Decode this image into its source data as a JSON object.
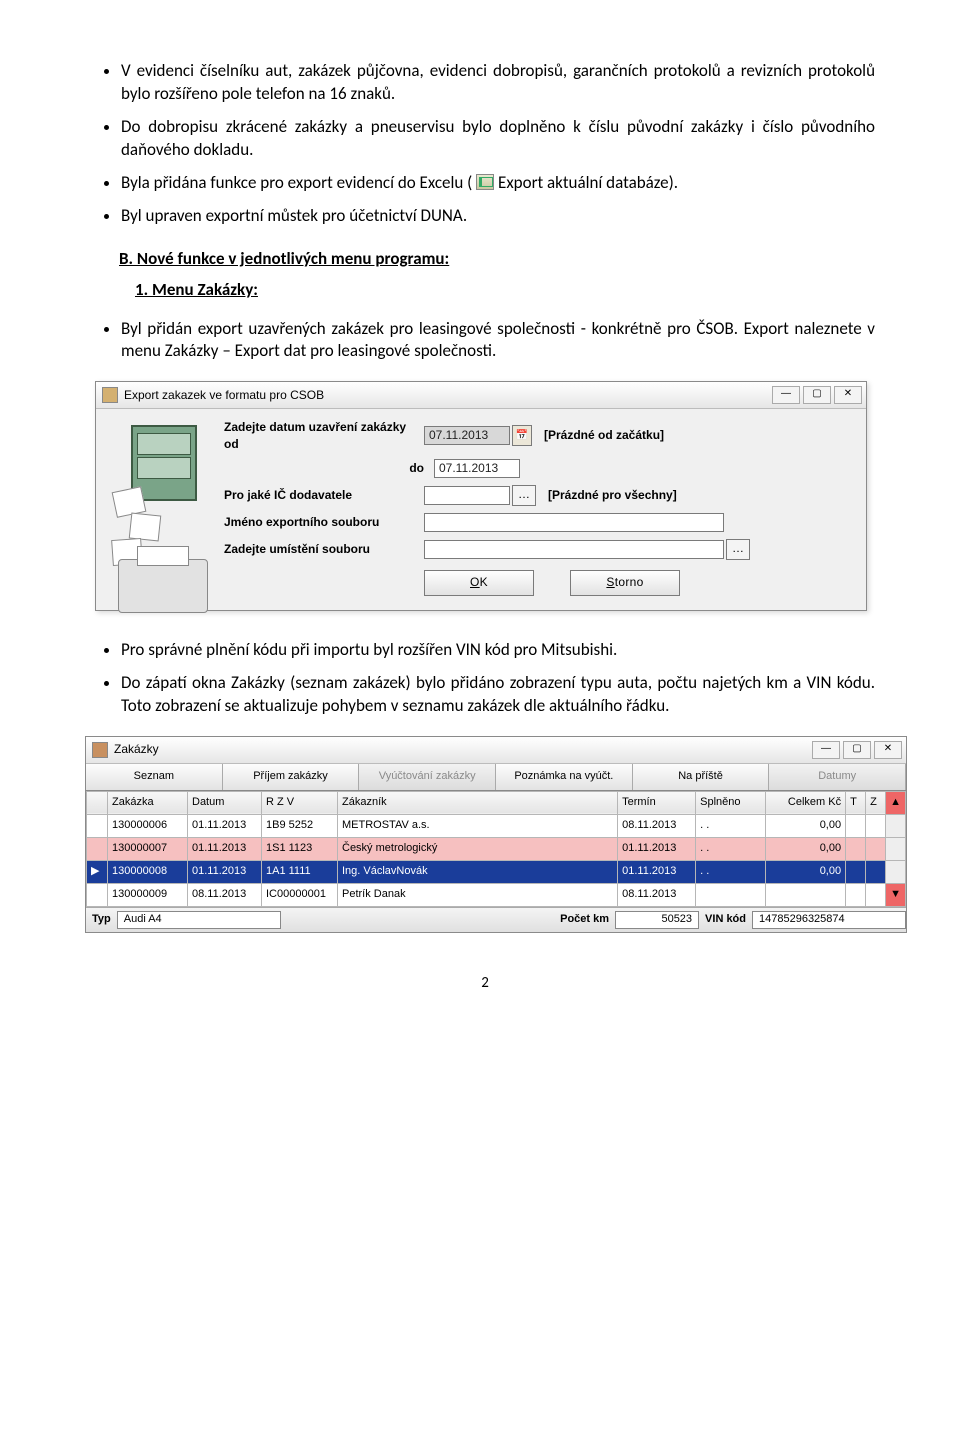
{
  "bullets1": [
    "V evidenci číselníku aut, zakázek půjčovna, evidenci dobropisů, garančních protokolů a revizních protokolů bylo rozšířeno pole telefon na 16 znaků.",
    "Do dobropisu zkrácené zakázky a pneuservisu bylo doplněno k číslu původní zakázky i číslo původního daňového dokladu."
  ],
  "bullet_export_pre": "Byla přidána funkce pro export evidencí do Excelu (",
  "bullet_export_post": " Export aktuální databáze).",
  "bullet_mustek": "Byl upraven exportní můstek pro účetnictví DUNA.",
  "section_b": "B.  Nové funkce v jednotlivých menu programu:",
  "menu_zak": "1.  Menu Zakázky:",
  "bullet_csob": "Byl přidán export uzavřených zakázek pro leasingové společnosti - konkrétně pro ČSOB. Export naleznete v menu Zakázky – Export dat pro leasingové společnosti.",
  "dlg": {
    "title": "Export zakazek ve formatu pro CSOB",
    "lbl_od": "Zadejte datum uzavření zakázky od",
    "lbl_do": "do",
    "date_from": "07.11.2013",
    "date_to": "07.11.2013",
    "hint_from": "[Prázdné od začátku]",
    "lbl_ic": "Pro jaké IČ dodavatele",
    "hint_ic": "[Prázdné pro všechny]",
    "lbl_file": "Jméno exportního souboru",
    "lbl_path": "Zadejte umístění souboru",
    "btn_ok": "OK",
    "btn_storno": "Storno"
  },
  "bullet_vin": "Pro správné plnění kódu při importu byl rozšířen VIN kód pro Mitsubishi.",
  "bullet_zapati": "Do zápatí okna Zakázky (seznam zakázek) bylo přidáno zobrazení typu auta, počtu najetých km a VIN kódu. Toto zobrazení se aktualizuje pohybem v seznamu zakázek dle aktuálního řádku.",
  "gridwin": {
    "title": "Zakázky",
    "tabs": [
      "Seznam",
      "Příjem zakázky",
      "Vyúčtování zakázky",
      "Poznámka na vyúčt.",
      "Na příště",
      "Datumy"
    ],
    "headers": [
      "Zakázka",
      "Datum",
      "R Z V",
      "Zákazník",
      "Termín",
      "Splněno",
      "Celkem Kč",
      "T",
      "Z"
    ],
    "rows": [
      {
        "c": [
          "130000006",
          "01.11.2013",
          "1B9 5252",
          "METROSTAV a.s.",
          "08.11.2013",
          ".  .",
          "0,00",
          "",
          ""
        ],
        "cls": ""
      },
      {
        "c": [
          "130000007",
          "01.11.2013",
          "1S1 1123",
          "Český metrologický",
          "01.11.2013",
          ".  .",
          "0,00",
          "",
          ""
        ],
        "cls": "red"
      },
      {
        "c": [
          "130000008",
          "01.11.2013",
          "1A1 1111",
          "Ing. VáclavNovák",
          "01.11.2013",
          ".  .",
          "0,00",
          "",
          ""
        ],
        "cls": "sel"
      },
      {
        "c": [
          "130000009",
          "08.11.2013",
          "IC00000001",
          "Petrík Danak",
          "08.11.2013",
          "",
          "",
          "",
          ""
        ],
        "cls": ""
      }
    ],
    "footer": {
      "typ_lbl": "Typ",
      "typ_val": "Audi A4",
      "km_lbl": "Počet km",
      "km_val": "50523",
      "vin_lbl": "VIN kód",
      "vin_val": "14785296325874"
    }
  },
  "page": "2"
}
